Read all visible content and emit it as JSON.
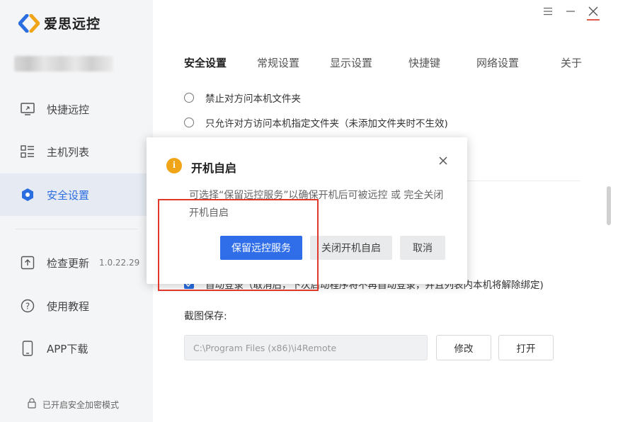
{
  "app": {
    "name": "爱思远控"
  },
  "colors": {
    "accent": "#2a6de0",
    "primary_button": "#2f6ee8",
    "warning": "#f0a417",
    "highlight_box": "#e0392b"
  },
  "sidebar": {
    "items": [
      {
        "label": "快捷远控",
        "icon": "monitor-icon"
      },
      {
        "label": "主机列表",
        "icon": "list-icon"
      },
      {
        "label": "安全设置",
        "icon": "shield-icon",
        "active": true
      },
      {
        "label": "检查更新",
        "icon": "upload-icon",
        "version": "1.0.22.29"
      },
      {
        "label": "使用教程",
        "icon": "help-icon"
      },
      {
        "label": "APP下载",
        "icon": "phone-icon"
      }
    ],
    "footer": "已开启安全加密模式"
  },
  "tabs": [
    {
      "label": "安全设置",
      "active": true
    },
    {
      "label": "常规设置"
    },
    {
      "label": "显示设置"
    },
    {
      "label": "快捷键"
    },
    {
      "label": "网络设置"
    },
    {
      "label": "关于"
    }
  ],
  "settings": {
    "file_options": [
      {
        "label": "禁止对方问本机文件夹"
      },
      {
        "label": "只允许对方访问本机指定文件夹（未添加文件夹时不生效)"
      }
    ],
    "auto_login": "自动登录（取消后，下次启动程序将不再自动登录，并且列表内本机将解除绑定)",
    "screenshot_label": "截图保存:",
    "screenshot_path": "C:\\Program Files (x86)\\i4Remote",
    "modify_btn": "修改",
    "open_btn": "打开"
  },
  "dialog": {
    "title": "开机自启",
    "body": "可选择“保留远控服务”以确保开机后可被远控 或 完全关闭开机自启",
    "btn_keep": "保留远控服务",
    "btn_disable": "关闭开机自启",
    "btn_cancel": "取消"
  }
}
